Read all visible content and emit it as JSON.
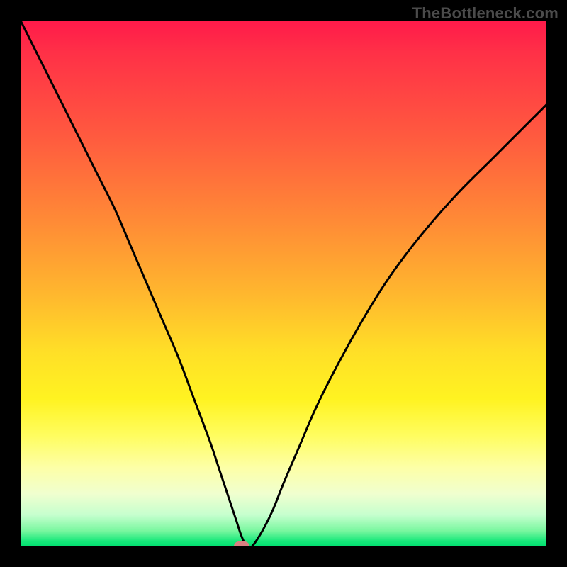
{
  "watermark": "TheBottleneck.com",
  "chart_data": {
    "type": "line",
    "title": "",
    "xlabel": "",
    "ylabel": "",
    "xlim": [
      0,
      100
    ],
    "ylim": [
      0,
      100
    ],
    "grid": false,
    "series": [
      {
        "name": "curve",
        "x": [
          0,
          3,
          6,
          9,
          12,
          15,
          18,
          21,
          24,
          27,
          30,
          33,
          36,
          38,
          40,
          41,
          42,
          43,
          44,
          46,
          48,
          50,
          53,
          56,
          60,
          65,
          70,
          76,
          83,
          90,
          97,
          100
        ],
        "values": [
          100,
          94,
          88,
          82,
          76,
          70,
          64,
          57,
          50,
          43,
          36,
          28,
          20,
          14,
          8,
          5,
          2,
          0,
          0,
          3,
          7,
          12,
          19,
          26,
          34,
          43,
          51,
          59,
          67,
          74,
          81,
          84
        ]
      }
    ],
    "marker": {
      "x": 42,
      "y": 0,
      "color": "#d98082"
    },
    "background_gradient": {
      "top": "#ff1a4a",
      "bottom": "#00e070",
      "type": "red-to-green"
    }
  }
}
